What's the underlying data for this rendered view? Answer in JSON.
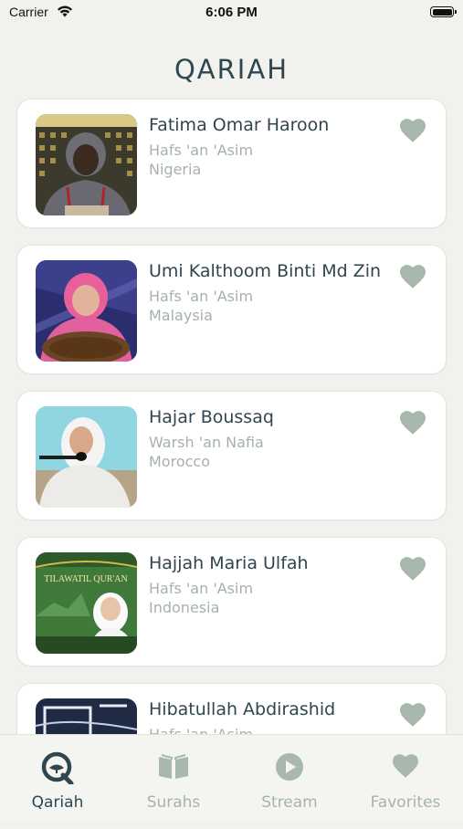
{
  "status_bar": {
    "carrier": "Carrier",
    "time": "6:06 PM"
  },
  "header": {
    "title": "QARIAH"
  },
  "reciters": [
    {
      "name": "Fatima Omar Haroon",
      "riwaya": "Hafs 'an 'Asim",
      "country": "Nigeria"
    },
    {
      "name": "Umi Kalthoom Binti Md Zin",
      "riwaya": "Hafs 'an 'Asim",
      "country": "Malaysia"
    },
    {
      "name": "Hajar Boussaq",
      "riwaya": "Warsh 'an Nafia",
      "country": "Morocco"
    },
    {
      "name": "Hajjah Maria Ulfah",
      "riwaya": "Hafs 'an 'Asim",
      "country": "Indonesia",
      "thumbnail_text": "TILAWATIL QUR'AN"
    },
    {
      "name": "Hibatullah Abdirashid",
      "riwaya": "Hafs 'an 'Asim",
      "country": ""
    }
  ],
  "tabbar": {
    "tabs": [
      {
        "label": "Qariah",
        "icon": "qariah-logo-icon",
        "active": true
      },
      {
        "label": "Surahs",
        "icon": "book-icon",
        "active": false
      },
      {
        "label": "Stream",
        "icon": "play-icon",
        "active": false
      },
      {
        "label": "Favorites",
        "icon": "heart-icon",
        "active": false
      }
    ]
  },
  "colors": {
    "accent": "#2f4650",
    "heart": "#a8b8ad",
    "muted": "#a6b1ac",
    "background": "#f1f2ed"
  }
}
